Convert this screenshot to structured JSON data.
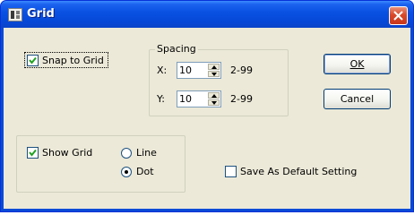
{
  "window": {
    "title": "Grid",
    "close_glyph": "×"
  },
  "snap": {
    "label": "Snap to Grid",
    "checked": true
  },
  "spacing": {
    "legend": "Spacing",
    "x": {
      "label": "X:",
      "value": "10",
      "range": "2-99"
    },
    "y": {
      "label": "Y:",
      "value": "10",
      "range": "2-99"
    }
  },
  "buttons": {
    "ok": "OK",
    "cancel": "Cancel"
  },
  "show_grid": {
    "label": "Show Grid",
    "checked": true,
    "options": [
      {
        "label": "Line",
        "selected": false
      },
      {
        "label": "Dot",
        "selected": true
      }
    ]
  },
  "save_default": {
    "label": "Save As Default Setting",
    "checked": false
  },
  "colors": {
    "title_bar": "#0a52e3",
    "dialog_bg": "#ece9d8",
    "close": "#d84a2a"
  }
}
